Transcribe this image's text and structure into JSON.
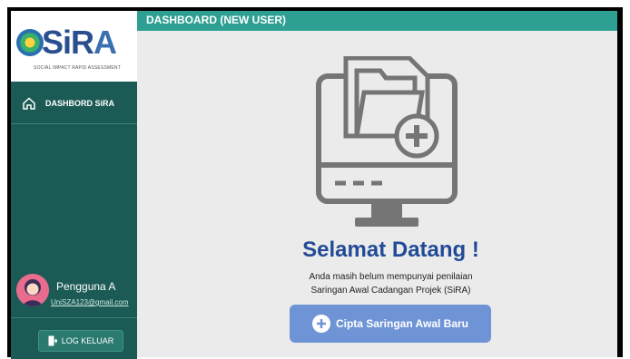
{
  "header": {
    "title": "DASHBOARD (NEW USER)"
  },
  "logo": {
    "text_main": "SiR",
    "text_accent": "A",
    "subtitle": "SOCIAL IMPACT RAPID ASSESSMENT"
  },
  "sidebar": {
    "items": [
      {
        "label": "DASHBORD SiRA",
        "icon": "home-icon"
      }
    ]
  },
  "user": {
    "name": "Pengguna A",
    "email": "UniSZA123@gmail.com"
  },
  "logout": {
    "label": "LOG KELUAR",
    "icon": "logout-icon"
  },
  "main": {
    "welcome": "Selamat Datang !",
    "desc_line1": "Anda masih belum mempunyai penilaian",
    "desc_line2": "Saringan Awal Cadangan Projek (SiRA)",
    "create_button": "Cipta Saringan Awal Baru"
  },
  "colors": {
    "sidebar": "#1c5b55",
    "header": "#2e9f93",
    "welcome": "#224a96",
    "button": "#6f94d6"
  }
}
